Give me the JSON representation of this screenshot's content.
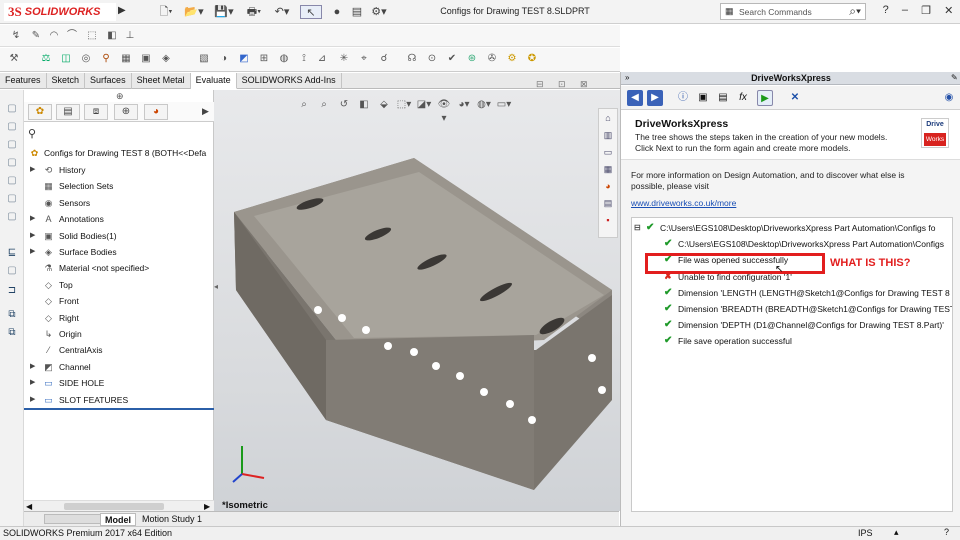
{
  "app": {
    "logo_mark": "3S",
    "logo_text": "SOLIDWORKS",
    "title": "Configs for Drawing TEST 8.SLDPRT"
  },
  "search": {
    "placeholder": "Search Commands"
  },
  "window_buttons": {
    "help": "?",
    "minimize": "–",
    "restore": "❐",
    "close": "✕"
  },
  "tabs": [
    "Features",
    "Sketch",
    "Surfaces",
    "Sheet Metal",
    "Evaluate",
    "SOLIDWORKS Add-Ins"
  ],
  "active_tab": "Evaluate",
  "feature_tree": {
    "root": "Configs for Drawing TEST 8  (BOTH<<Defa",
    "items": [
      {
        "label": "History",
        "expand": true
      },
      {
        "label": "Selection Sets",
        "expand": false
      },
      {
        "label": "Sensors",
        "expand": false
      },
      {
        "label": "Annotations",
        "expand": true
      },
      {
        "label": "Solid Bodies(1)",
        "expand": true
      },
      {
        "label": "Surface Bodies",
        "expand": true
      },
      {
        "label": "Material <not specified>",
        "expand": false
      },
      {
        "label": "Top",
        "expand": false
      },
      {
        "label": "Front",
        "expand": false
      },
      {
        "label": "Right",
        "expand": false
      },
      {
        "label": "Origin",
        "expand": false
      },
      {
        "label": "CentralAxis",
        "expand": false
      },
      {
        "label": "Channel",
        "expand": true
      },
      {
        "label": "SIDE HOLE",
        "expand": true
      },
      {
        "label": "SLOT FEATURES",
        "expand": true
      }
    ]
  },
  "bottom_tabs": [
    "Model",
    "Motion Study 1"
  ],
  "view_label": "*Isometric",
  "status": {
    "left": "SOLIDWORKS Premium 2017 x64 Edition",
    "units": "IPS"
  },
  "driveworks": {
    "panel_title": "DriveWorksXpress",
    "heading": "DriveWorksXpress",
    "sub1": "The tree shows the steps taken in the creation of your new models.",
    "sub2": "Click Next to run the form again and create more models.",
    "logo_top": "Drive",
    "logo_bottom": "Works",
    "info1": "For more information on Design Automation, and to discover what else is",
    "info2": "possible, please visit",
    "link": "www.driveworks.co.uk/more",
    "tree": [
      {
        "text": "C:\\Users\\EGS108\\Desktop\\DriveworksXpress Part Automation\\Configs fo",
        "status": "ok",
        "level": 0
      },
      {
        "text": "C:\\Users\\EGS108\\Desktop\\DriveworksXpress Part Automation\\Configs",
        "status": "ok",
        "level": 1
      },
      {
        "text": "File was opened successfully",
        "status": "ok",
        "level": 1
      },
      {
        "text": "Unable to find configuration '1'",
        "status": "error",
        "level": 1
      },
      {
        "text": "Dimension 'LENGTH (LENGTH@Sketch1@Configs for Drawing TEST 8",
        "status": "ok",
        "level": 1
      },
      {
        "text": "Dimension 'BREADTH (BREADTH@Sketch1@Configs for Drawing TEST",
        "status": "ok",
        "level": 1
      },
      {
        "text": "Dimension 'DEPTH (D1@Channel@Configs for Drawing TEST 8.Part)'",
        "status": "ok",
        "level": 1
      },
      {
        "text": "File save operation successful",
        "status": "ok",
        "level": 1
      }
    ]
  },
  "annotation": "WHAT IS THIS?",
  "colors": {
    "ok": "#1f9a2a",
    "error": "#d9261c",
    "annotation": "#e21e1e",
    "link": "#1a4fb5"
  }
}
